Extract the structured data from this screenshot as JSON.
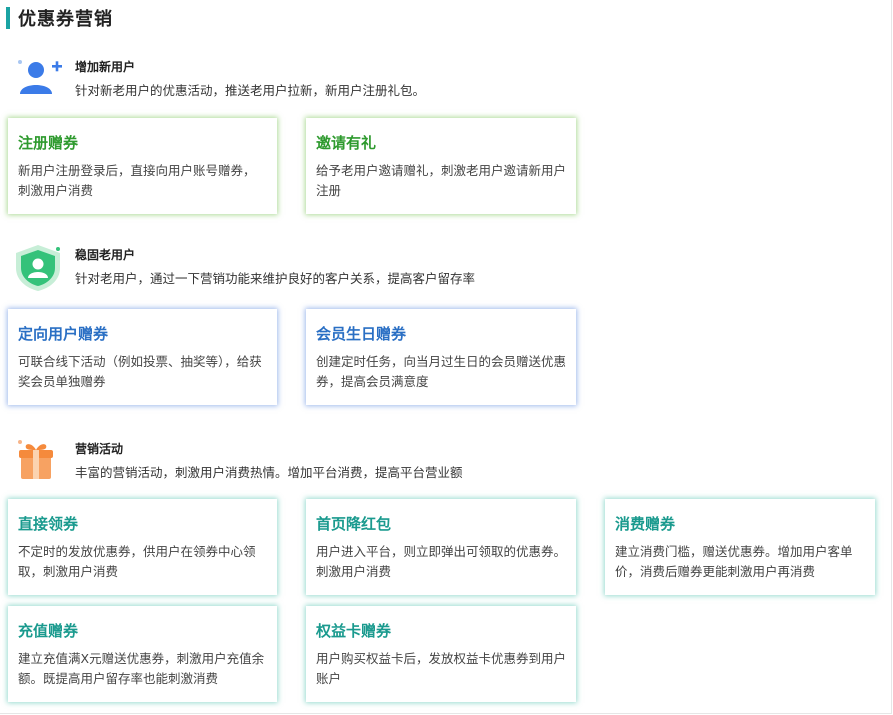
{
  "page": {
    "title": "优惠券营销",
    "accent_color": "#1aa3a3"
  },
  "sections": [
    {
      "icon": "add-user-icon",
      "title": "增加新用户",
      "desc": "针对新老用户的优惠活动，推送老用户拉新，新用户注册礼包。",
      "color": "#2e9a2e",
      "cards": [
        {
          "title": "注册赠券",
          "desc": "新用户注册登录后，直接向用户账号赠券，刺激用户消费"
        },
        {
          "title": "邀请有礼",
          "desc": "给予老用户邀请赠礼，刺激老用户邀请新用户注册"
        }
      ]
    },
    {
      "icon": "shield-user-icon",
      "title": "稳固老用户",
      "desc": "针对老用户，通过一下营销功能来维护良好的客户关系，提高客户留存率",
      "color": "#2a6fc4",
      "cards": [
        {
          "title": "定向用户赠券",
          "desc": "可联合线下活动（例如投票、抽奖等），给获奖会员单独赠券"
        },
        {
          "title": "会员生日赠券",
          "desc": "创建定时任务，向当月过生日的会员赠送优惠券，提高会员满意度"
        }
      ]
    },
    {
      "icon": "gift-icon",
      "title": "营销活动",
      "desc": "丰富的营销活动，刺激用户消费热情。增加平台消费，提高平台营业额",
      "color": "#1a9a8e",
      "cards": [
        {
          "title": "直接领券",
          "desc": "不定时的发放优惠券，供用户在领券中心领取，刺激用户消费"
        },
        {
          "title": "首页降红包",
          "desc": "用户进入平台，则立即弹出可领取的优惠券。刺激用户消费"
        },
        {
          "title": "消费赠券",
          "desc": "建立消费门槛，赠送优惠券。增加用户客单价，消费后赠券更能刺激用户再消费"
        },
        {
          "title": "充值赠券",
          "desc": "建立充值满X元赠送优惠券，刺激用户充值余额。既提高用户留存率也能刺激消费"
        },
        {
          "title": "权益卡赠券",
          "desc": "用户购买权益卡后，发放权益卡优惠券到用户账户"
        }
      ]
    }
  ]
}
